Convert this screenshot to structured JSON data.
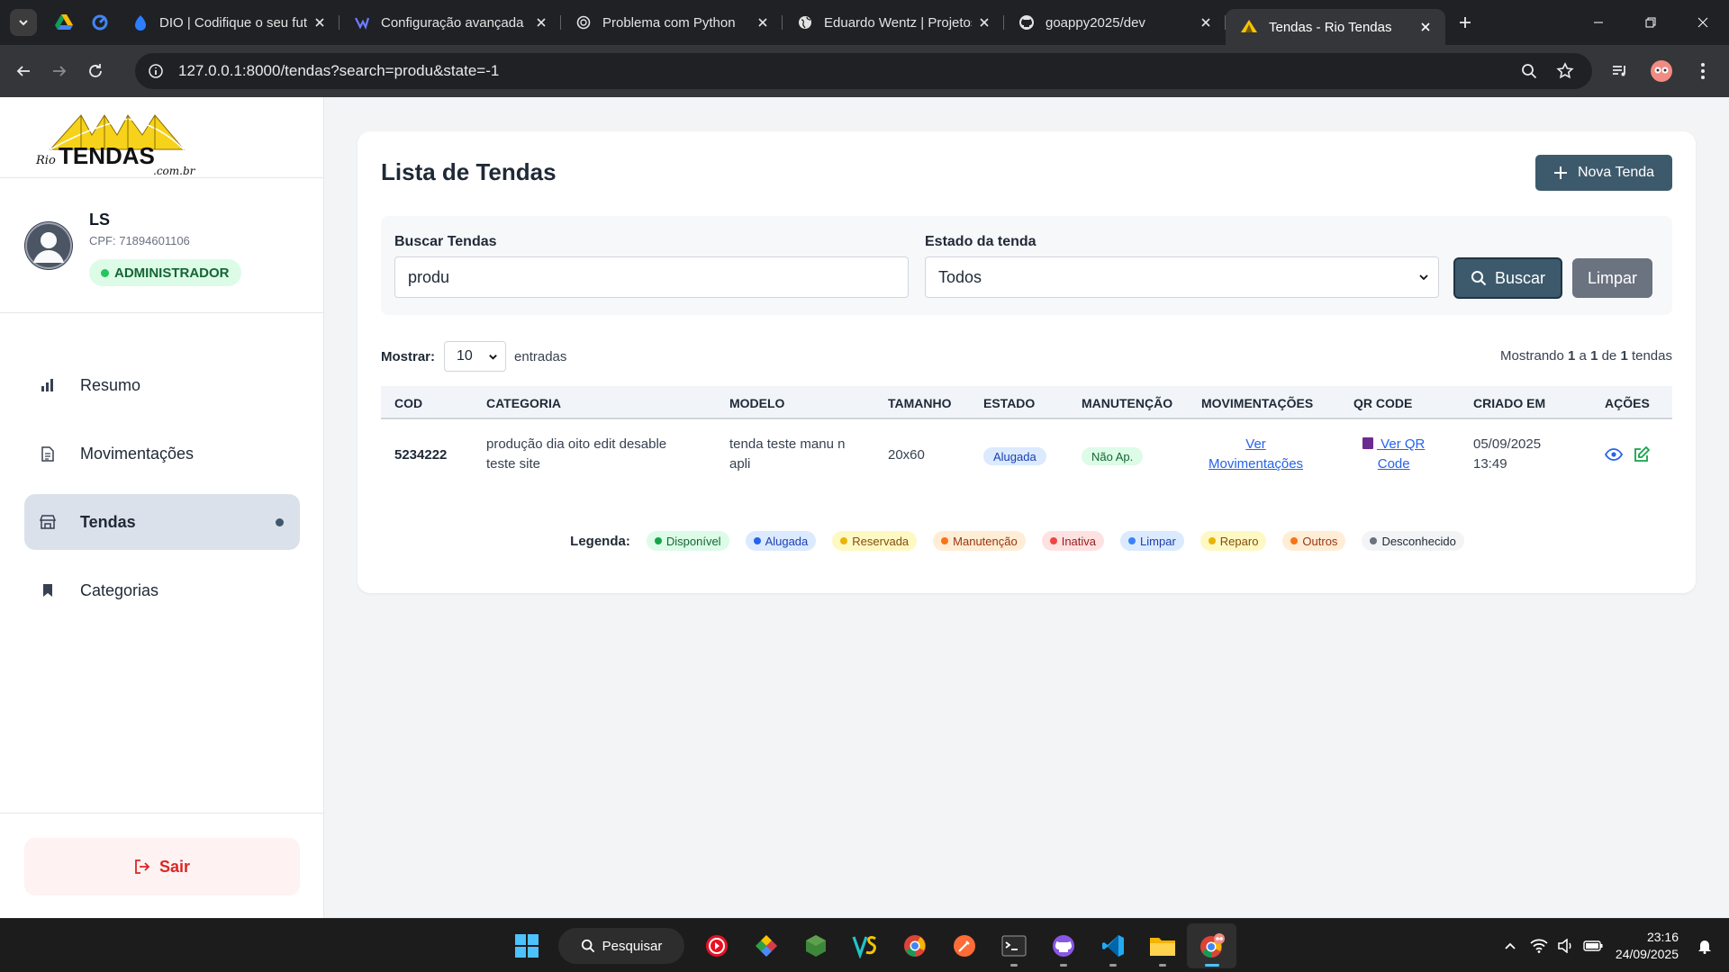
{
  "browser": {
    "tabs": [
      {
        "title": "DIO | Codifique o seu futuro",
        "icon": "dio-icon"
      },
      {
        "title": "Configuração avançada",
        "icon": "config-icon"
      },
      {
        "title": "Problema com Python",
        "icon": "chatgpt-icon"
      },
      {
        "title": "Eduardo Wentz | Projetos",
        "icon": "globe-icon"
      },
      {
        "title": "goappy2025/dev",
        "icon": "github-icon"
      },
      {
        "title": "Tendas - Rio Tendas",
        "icon": "tent-icon",
        "active": true
      }
    ],
    "url": "127.0.0.1:8000/tendas?search=produ&state=-1"
  },
  "sidebar": {
    "logo_text": "Rio TENDAS .com.br",
    "user": {
      "name": "LS",
      "cpf": "CPF: 71894601106",
      "role": "ADMINISTRADOR"
    },
    "items": [
      {
        "label": "Resumo",
        "icon": "bar-chart-icon"
      },
      {
        "label": "Movimentações",
        "icon": "document-icon"
      },
      {
        "label": "Tendas",
        "icon": "tent-store-icon",
        "active": true
      },
      {
        "label": "Categorias",
        "icon": "bookmark-icon"
      }
    ],
    "logout_label": "Sair"
  },
  "main": {
    "title": "Lista de Tendas",
    "new_button": "Nova Tenda",
    "filters": {
      "search_label": "Buscar Tendas",
      "search_value": "produ",
      "state_label": "Estado da tenda",
      "state_value": "Todos",
      "search_button": "Buscar",
      "clear_button": "Limpar"
    },
    "show": {
      "prefix": "Mostrar:",
      "value": "10",
      "suffix": "entradas"
    },
    "showing": {
      "a": "Mostrando",
      "from": "1",
      "b": "a",
      "to": "1",
      "c": "de",
      "total": "1",
      "d": "tendas"
    },
    "columns": [
      "COD",
      "CATEGORIA",
      "MODELO",
      "TAMANHO",
      "ESTADO",
      "MANUTENÇÃO",
      "MOVIMENTAÇÕES",
      "QR CODE",
      "CRIADO EM",
      "AÇÕES"
    ],
    "rows": [
      {
        "cod": "5234222",
        "categoria_1": "produção dia oito edit desable",
        "categoria_2": "teste site",
        "modelo_1": "tenda teste manu n",
        "modelo_2": "apli",
        "tamanho": "20x60",
        "estado": "Alugada",
        "manutencao": "Não Ap.",
        "mov_1": "Ver",
        "mov_2": "Movimentações",
        "qr_1": "Ver QR",
        "qr_2": "Code",
        "data": "05/09/2025",
        "hora": "13:49"
      }
    ],
    "legend": {
      "title": "Legenda:",
      "items": [
        {
          "label": "Disponível",
          "bg": "#dcfce7",
          "dot": "#16a34a",
          "fg": "#166534"
        },
        {
          "label": "Alugada",
          "bg": "#dbeafe",
          "dot": "#2563eb",
          "fg": "#1e40af"
        },
        {
          "label": "Reservada",
          "bg": "#fef9c3",
          "dot": "#eab308",
          "fg": "#854d0e"
        },
        {
          "label": "Manutenção",
          "bg": "#ffedd5",
          "dot": "#f97316",
          "fg": "#9a3412"
        },
        {
          "label": "Inativa",
          "bg": "#fee2e2",
          "dot": "#ef4444",
          "fg": "#991b1b"
        },
        {
          "label": "Limpar",
          "bg": "#dbeafe",
          "dot": "#3b82f6",
          "fg": "#1e40af"
        },
        {
          "label": "Reparo",
          "bg": "#fef9c3",
          "dot": "#eab308",
          "fg": "#854d0e"
        },
        {
          "label": "Outros",
          "bg": "#ffedd5",
          "dot": "#f97316",
          "fg": "#9a3412"
        },
        {
          "label": "Desconhecido",
          "bg": "#f3f4f6",
          "dot": "#6b7280",
          "fg": "#1f2937"
        }
      ]
    }
  },
  "taskbar": {
    "search_label": "Pesquisar",
    "time": "23:16",
    "date": "24/09/2025"
  },
  "colors": {
    "primary": "#3d5a6c",
    "link": "#2563eb",
    "danger": "#dc2626"
  }
}
